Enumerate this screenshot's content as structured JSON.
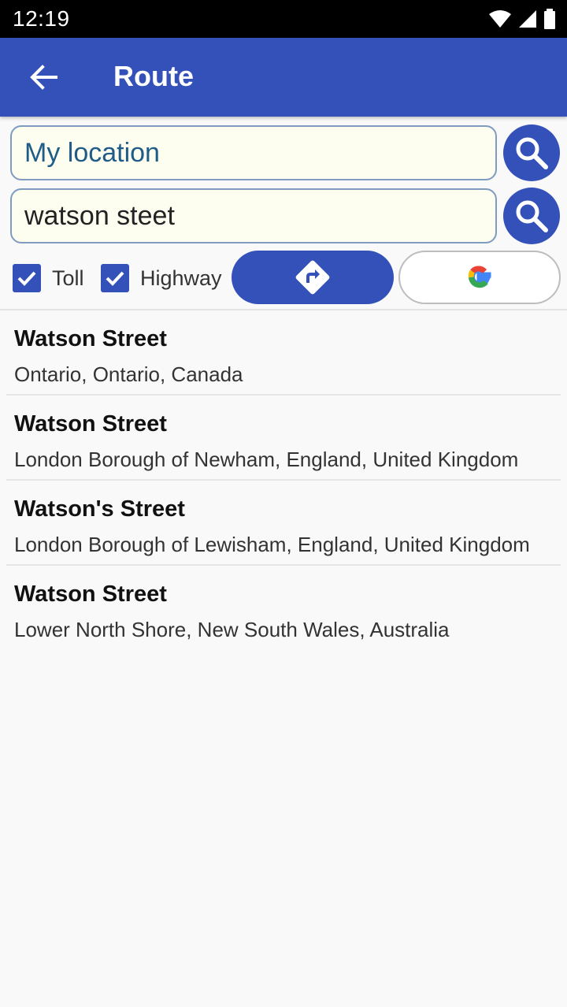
{
  "status_bar": {
    "time": "12:19",
    "icons": [
      "wifi-icon",
      "cell-signal-icon",
      "battery-icon"
    ]
  },
  "app_bar": {
    "title": "Route",
    "back_icon": "arrow-left-icon",
    "color": "#3351b8"
  },
  "route_form": {
    "from_value": "My location",
    "to_value": "watson steet",
    "search_icon": "search-icon"
  },
  "options": {
    "toll_label": "Toll",
    "toll_checked": true,
    "highway_label": "Highway",
    "highway_checked": true,
    "route_icon": "directions-icon",
    "google_icon": "google-g-icon"
  },
  "results": [
    {
      "name": "Watson Street",
      "address": "Ontario, Ontario, Canada"
    },
    {
      "name": "Watson Street",
      "address": "London Borough of Newham, England, United Kingdom"
    },
    {
      "name": "Watson's Street",
      "address": "London Borough of Lewisham, England, United Kingdom"
    },
    {
      "name": "Watson Street",
      "address": "Lower North Shore, New South Wales, Australia"
    }
  ]
}
